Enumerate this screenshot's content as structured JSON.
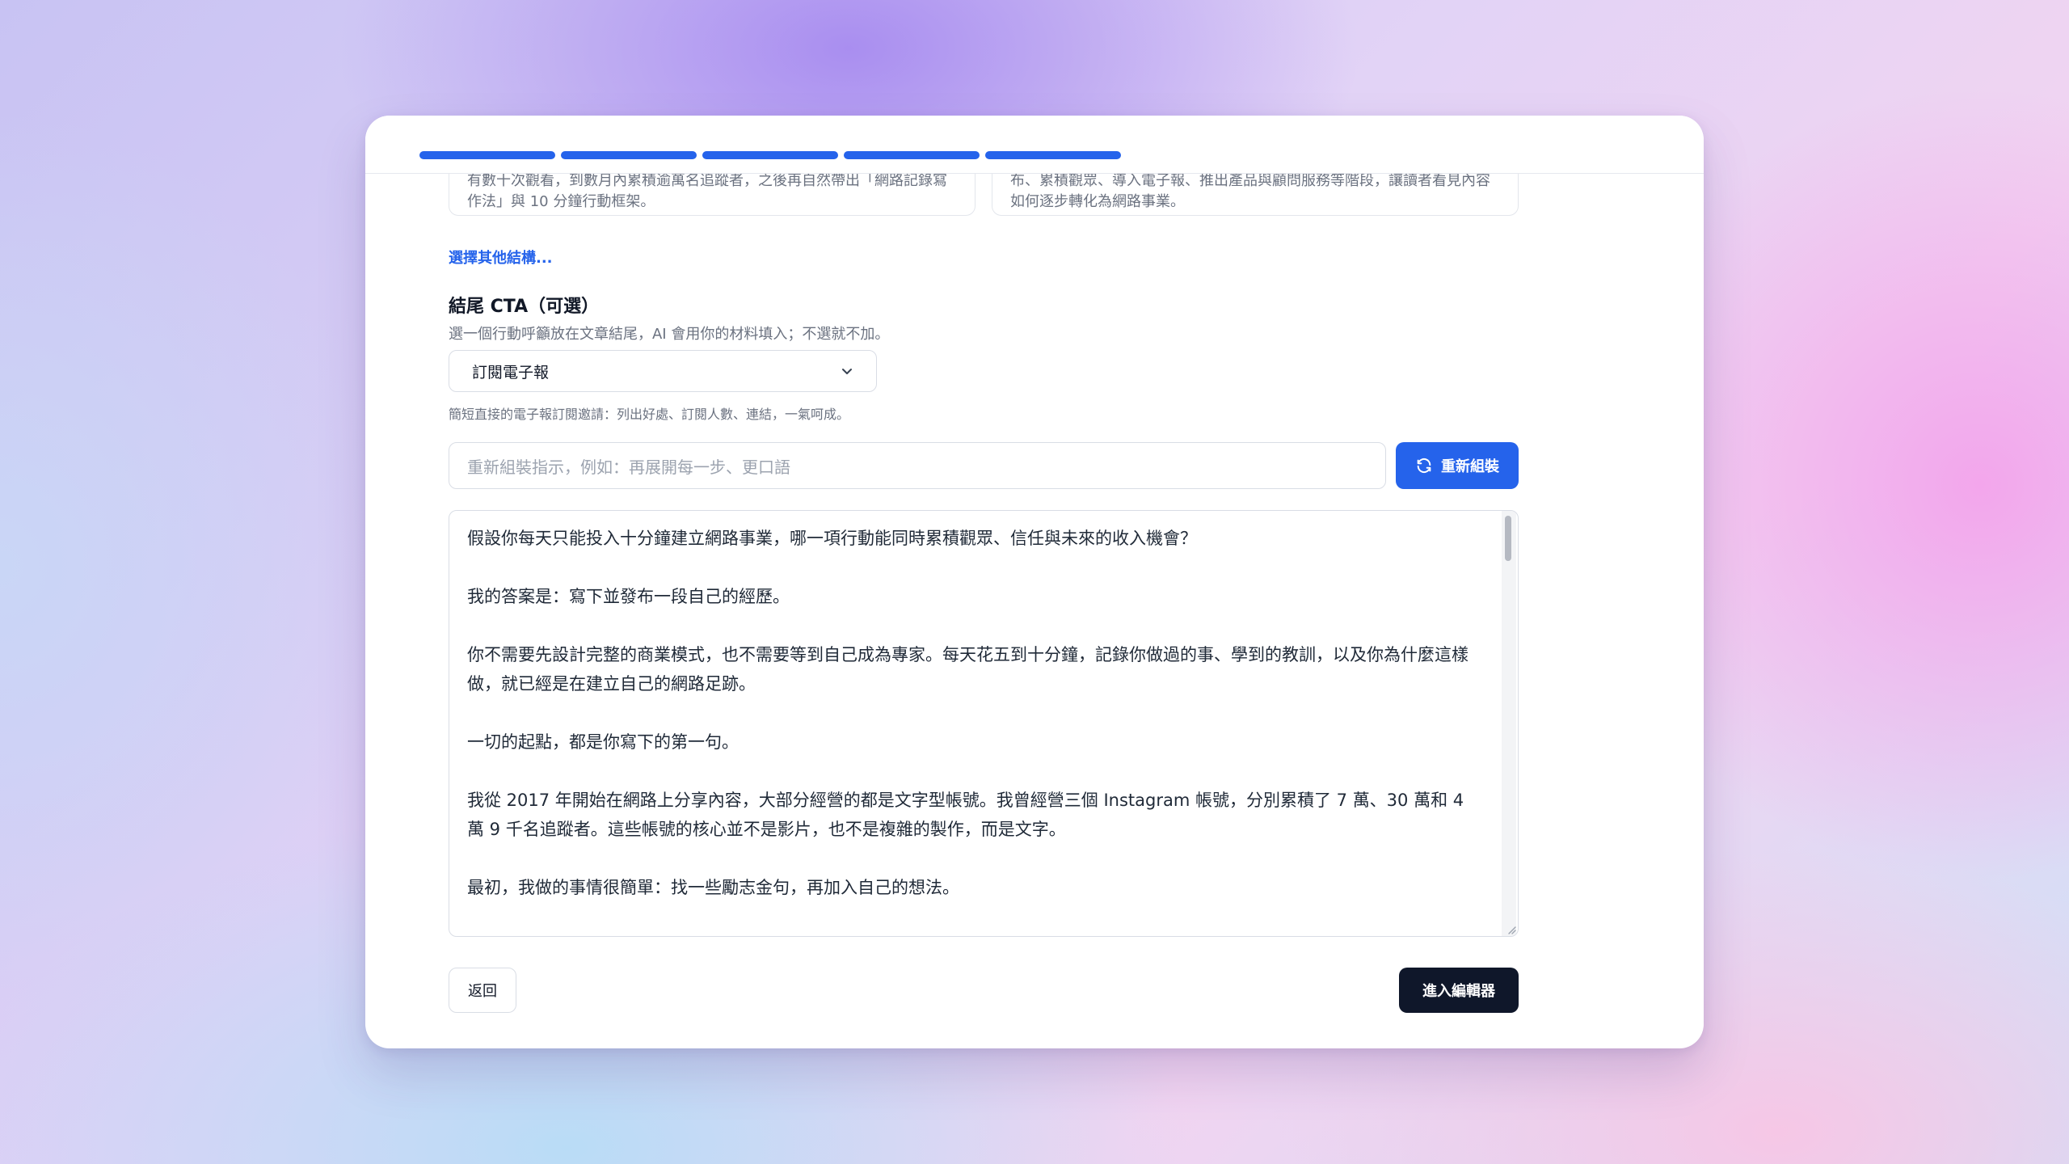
{
  "structure_cards": [
    {
      "text": "有數十次觀看，到數月內累積逾萬名追蹤者，之後再自然帶出「網路記錄寫作法」與 10 分鐘行動框架。"
    },
    {
      "text": "布、累積觀眾、導入電子報、推出產品與顧問服務等階段，讓讀者看見內容如何逐步轉化為網路事業。"
    }
  ],
  "other_structure_link": "選擇其他結構...",
  "cta": {
    "title": "結尾 CTA（可選）",
    "subtitle": "選一個行動呼籲放在文章結尾，AI 會用你的材料填入；不選就不加。",
    "selected": "訂閱電子報",
    "hint": "簡短直接的電子報訂閱邀請：列出好處、訂閱人數、連結，一氣呵成。"
  },
  "reassemble": {
    "placeholder": "重新組裝指示，例如：再展開每一步、更口語",
    "button": "重新組裝"
  },
  "draft": {
    "paragraphs": [
      "假設你每天只能投入十分鐘建立網路事業，哪一項行動能同時累積觀眾、信任與未來的收入機會？",
      "我的答案是：寫下並發布一段自己的經歷。",
      "你不需要先設計完整的商業模式，也不需要等到自己成為專家。每天花五到十分鐘，記錄你做過的事、學到的教訓，以及你為什麼這樣做，就已經是在建立自己的網路足跡。",
      "一切的起點，都是你寫下的第一句。",
      "我從 2017 年開始在網路上分享內容，大部分經營的都是文字型帳號。我曾經營三個 Instagram 帳號，分別累積了 7 萬、30 萬和 4 萬 9 千名追蹤者。這些帳號的核心並不是影片，也不是複雜的製作，而是文字。",
      "最初，我做的事情很簡單：找一些勵志金句，再加入自己的想法。"
    ]
  },
  "buttons": {
    "back": "返回",
    "enter_editor": "進入編輯器"
  },
  "colors": {
    "accent": "#2563eb",
    "dark_button": "#0f172a"
  },
  "icons": {
    "refresh": "refresh-icon",
    "chevron": "chevron-down-icon"
  }
}
